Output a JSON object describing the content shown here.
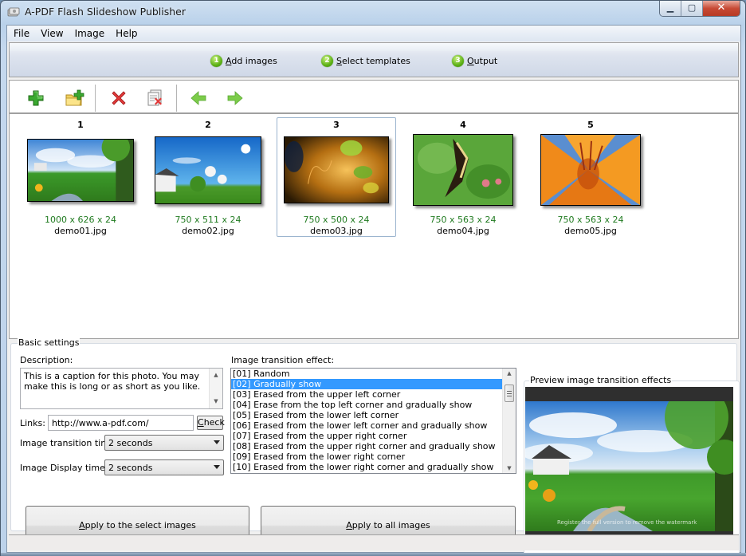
{
  "window": {
    "title": "A-PDF Flash Slideshow Publisher",
    "icon": "app-icon",
    "controls": [
      "minimize-icon",
      "maximize-icon",
      "close-icon"
    ]
  },
  "menu": [
    {
      "label": "File"
    },
    {
      "label": "View"
    },
    {
      "label": "Image"
    },
    {
      "label": "Help"
    }
  ],
  "steps": [
    {
      "num": "1",
      "label": "Add images",
      "accel": "A"
    },
    {
      "num": "2",
      "label": "Select templates",
      "accel": "S"
    },
    {
      "num": "3",
      "label": "Output",
      "accel": "O"
    }
  ],
  "toolbar": {
    "buttons": [
      {
        "name": "add-image",
        "icon": "plus-icon"
      },
      {
        "name": "add-folder",
        "icon": "folder-add-icon"
      },
      {
        "name": "delete-image",
        "icon": "delete-x-icon"
      },
      {
        "name": "delete-all",
        "icon": "clear-all-icon"
      },
      {
        "name": "move-left",
        "icon": "arrow-left-icon"
      },
      {
        "name": "move-right",
        "icon": "arrow-right-icon"
      }
    ]
  },
  "images": [
    {
      "index": "1",
      "dims": "1000 x 626 x 24",
      "file": "demo01.jpg",
      "selected": false
    },
    {
      "index": "2",
      "dims": "750 x 511 x 24",
      "file": "demo02.jpg",
      "selected": false
    },
    {
      "index": "3",
      "dims": "750 x 500 x 24",
      "file": "demo03.jpg",
      "selected": true
    },
    {
      "index": "4",
      "dims": "750 x 563 x 24",
      "file": "demo04.jpg",
      "selected": false
    },
    {
      "index": "5",
      "dims": "750 x 563 x 24",
      "file": "demo05.jpg",
      "selected": false
    }
  ],
  "settings": {
    "group_label": "Basic settings",
    "description_label": "Description:",
    "description_value": "This is a caption for this photo. You may make this is long or as short as you like.",
    "links_label": "Links:",
    "links_value": "http://www.a-pdf.com/",
    "check_label": "Check",
    "transition_time_label": "Image transition time:",
    "transition_time_value": "2 seconds",
    "display_time_label": "Image Display time:",
    "display_time_value": "2 seconds",
    "effect_label": "Image transition effect:",
    "effects": [
      "[01] Random",
      "[02] Gradually show",
      "[03] Erased from the upper left corner",
      "[04] Erase from the top left corner and gradually show",
      "[05] Erased from the lower left corner",
      "[06] Erased from the lower left corner and gradually show",
      "[07] Erased from the upper right corner",
      "[08] Erased from the upper right corner and gradually show",
      "[09] Erased from the lower right corner",
      "[10] Erased from the lower right corner and gradually show"
    ],
    "selected_effect_index": 1,
    "preview_label": "Preview image transition effects",
    "preview_watermark": "Register the full version to remove the watermark",
    "apply_selected_label": "Apply to the select images",
    "apply_all_label": "Apply to all images"
  },
  "colors": {
    "accent_selection": "#3399ff",
    "dims_text": "#1f7a1f",
    "step_badge": "#5db116"
  }
}
